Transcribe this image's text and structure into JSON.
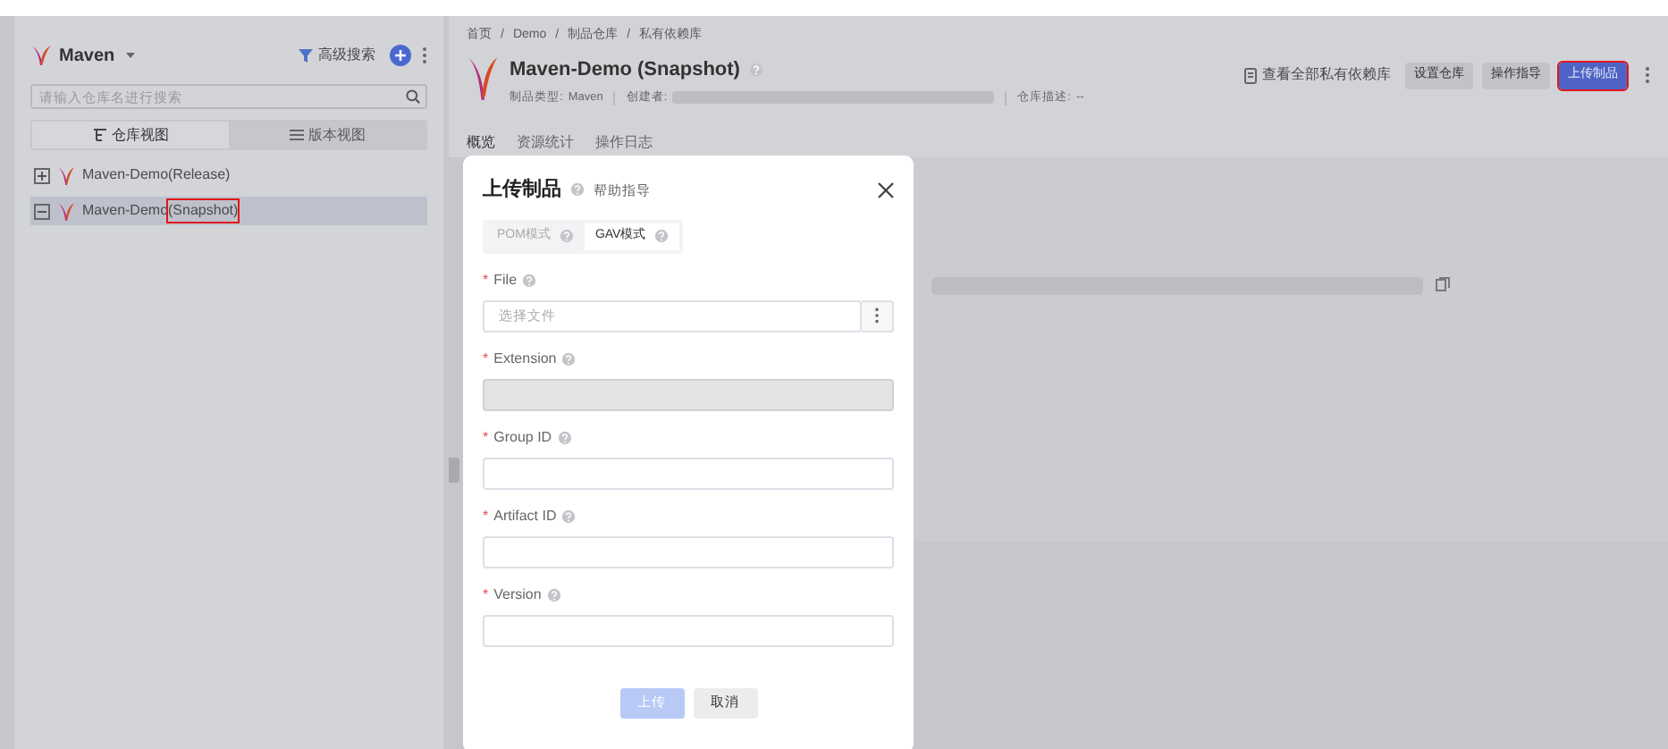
{
  "sidebar": {
    "title": "Maven",
    "advanced_search": "高级搜索",
    "search": {
      "placeholder": "请输入仓库名进行搜索"
    },
    "view_tabs": [
      {
        "label": "仓库视图",
        "selected": true
      },
      {
        "label": "版本视图",
        "selected": false
      }
    ],
    "tree": [
      {
        "name": "Maven-Demo",
        "tag": "(Release)",
        "expanded": false,
        "selected": false,
        "tag_highlighted": false
      },
      {
        "name": "Maven-Demo",
        "tag": "(Snapshot)",
        "expanded": true,
        "selected": true,
        "tag_highlighted": true
      }
    ]
  },
  "breadcrumb": {
    "separator": "/",
    "items": [
      "首页",
      "Demo",
      "制品仓库",
      "私有依赖库"
    ]
  },
  "repo": {
    "title": "Maven-Demo (Snapshot)",
    "type_label": "制品类型:",
    "type_value": "Maven",
    "creator_label": "创建者:",
    "description_label": "仓库描述:",
    "description_value": "--"
  },
  "header_actions": {
    "link": "查看全部私有依赖库",
    "buttons": [
      {
        "label": "设置仓库",
        "kind": "secondary",
        "highlighted": false
      },
      {
        "label": "操作指导",
        "kind": "secondary",
        "highlighted": false
      },
      {
        "label": "上传制品",
        "kind": "primary",
        "highlighted": true
      }
    ]
  },
  "tabs": [
    {
      "label": "概览",
      "selected": true
    },
    {
      "label": "资源统计",
      "selected": false
    },
    {
      "label": "操作日志",
      "selected": false
    }
  ],
  "dialog": {
    "title": "上传制品",
    "help": "帮助指导",
    "required_mark": "*",
    "modes": [
      {
        "label": "POM模式",
        "selected": false
      },
      {
        "label": "GAV模式",
        "selected": true
      }
    ],
    "fields": [
      {
        "label": "File",
        "required": true,
        "kind": "file",
        "placeholder": "选择文件",
        "disabled": false
      },
      {
        "label": "Extension",
        "required": true,
        "kind": "text",
        "disabled": true
      },
      {
        "label": "Group ID",
        "required": true,
        "kind": "text",
        "disabled": false
      },
      {
        "label": "Artifact ID",
        "required": true,
        "kind": "text",
        "disabled": false
      },
      {
        "label": "Version",
        "required": true,
        "kind": "text",
        "disabled": false
      }
    ],
    "buttons": [
      {
        "label": "上传",
        "kind": "primary",
        "disabled": true
      },
      {
        "label": "取消",
        "kind": "secondary",
        "disabled": false
      }
    ]
  }
}
